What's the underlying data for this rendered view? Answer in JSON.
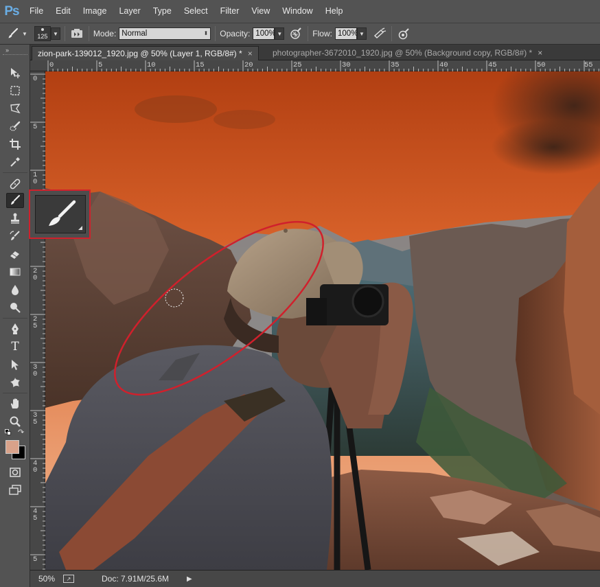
{
  "app": {
    "logo": "Ps"
  },
  "menu": [
    "File",
    "Edit",
    "Image",
    "Layer",
    "Type",
    "Select",
    "Filter",
    "View",
    "Window",
    "Help"
  ],
  "options": {
    "brush_size": "125",
    "mode_label": "Mode:",
    "mode_value": "Normal",
    "opacity_label": "Opacity:",
    "opacity_value": "100%",
    "flow_label": "Flow:",
    "flow_value": "100%"
  },
  "tabs": [
    {
      "label": "zion-park-139012_1920.jpg @ 50% (Layer 1, RGB/8#) *",
      "close": "×"
    },
    {
      "label": "photographer-3672010_1920.jpg @ 50% (Background copy, RGB/8#) *",
      "close": "×"
    }
  ],
  "ruler": {
    "h_ticks": [
      "0",
      "5",
      "10",
      "15",
      "20",
      "25",
      "30",
      "35",
      "40",
      "45",
      "50",
      "55"
    ],
    "v_ticks": [
      "0",
      "5",
      "1\n0",
      "1\n5",
      "2\n0",
      "2\n5",
      "3\n0",
      "3\n5",
      "4\n0",
      "4\n5",
      "5"
    ]
  },
  "tools": [
    "move-tool",
    "marquee-tool",
    "lasso-tool",
    "quick-select-tool",
    "crop-tool",
    "eyedropper-tool",
    "healing-tool",
    "brush-tool",
    "clone-stamp-tool",
    "history-brush-tool",
    "eraser-tool",
    "gradient-tool",
    "blur-tool",
    "dodge-tool",
    "pen-tool",
    "type-tool",
    "path-select-tool",
    "shape-tool",
    "hand-tool",
    "zoom-tool"
  ],
  "colors": {
    "foreground": "#d9a28a",
    "background": "#000000",
    "highlight": "#d0202c",
    "sky_top": "#b8471a",
    "sky_bottom": "#e8956a"
  },
  "status": {
    "zoom": "50%",
    "doc": "Doc: 7.91M/25.6M"
  }
}
